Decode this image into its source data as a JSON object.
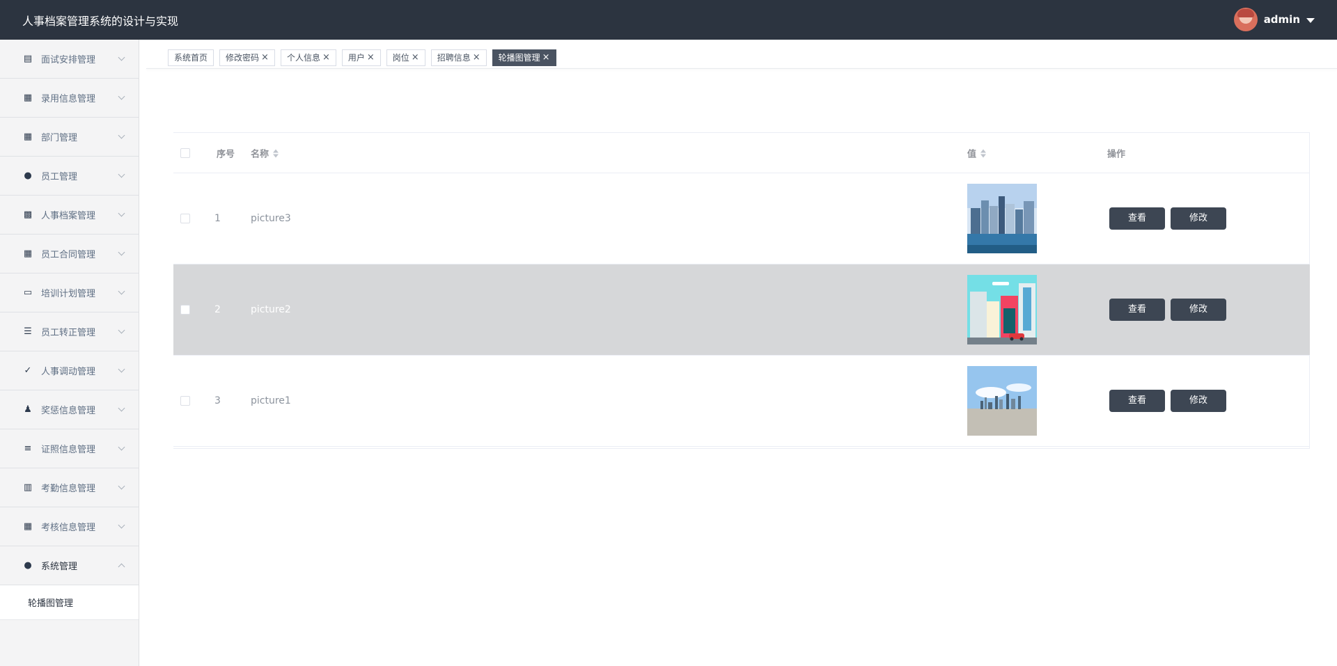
{
  "app": {
    "title": "人事档案管理系统的设计与实现"
  },
  "user": {
    "name": "admin"
  },
  "sidebar": {
    "items": [
      {
        "label": "面试安排管理",
        "icon": "clipboard-icon"
      },
      {
        "label": "录用信息管理",
        "icon": "grid-icon"
      },
      {
        "label": "部门管理",
        "icon": "grid-icon"
      },
      {
        "label": "员工管理",
        "icon": "balloon-icon"
      },
      {
        "label": "人事档案管理",
        "icon": "apps-icon"
      },
      {
        "label": "员工合同管理",
        "icon": "grid-icon"
      },
      {
        "label": "培训计划管理",
        "icon": "monitor-icon"
      },
      {
        "label": "员工转正管理",
        "icon": "list-icon"
      },
      {
        "label": "人事调动管理",
        "icon": "checklist-icon"
      },
      {
        "label": "奖惩信息管理",
        "icon": "user-icon"
      },
      {
        "label": "证照信息管理",
        "icon": "menu-icon"
      },
      {
        "label": "考勤信息管理",
        "icon": "bar-chart-icon"
      },
      {
        "label": "考核信息管理",
        "icon": "grid-icon"
      },
      {
        "label": "系统管理",
        "icon": "person-icon"
      }
    ],
    "submenu": {
      "label": "轮播图管理"
    }
  },
  "tabs": [
    {
      "label": "系统首页",
      "closable": false
    },
    {
      "label": "修改密码",
      "closable": true
    },
    {
      "label": "个人信息",
      "closable": true
    },
    {
      "label": "用户",
      "closable": true
    },
    {
      "label": "岗位",
      "closable": true
    },
    {
      "label": "招聘信息",
      "closable": true
    },
    {
      "label": "轮播图管理",
      "closable": true,
      "active": true
    }
  ],
  "table": {
    "headers": {
      "index": "序号",
      "name": "名称",
      "value": "值",
      "actions": "操作"
    },
    "rows": [
      {
        "index": "1",
        "name": "picture3",
        "image": "city-skyline-photo"
      },
      {
        "index": "2",
        "name": "picture2",
        "image": "cartoon-city-illustration"
      },
      {
        "index": "3",
        "name": "picture1",
        "image": "city-horizon-photo"
      }
    ],
    "buttons": {
      "view": "查看",
      "edit": "修改"
    }
  },
  "colors": {
    "topbar": "#2c3440",
    "button": "#3d4653",
    "active_tab": "#4a5361",
    "selected_row": "#d6d7d9"
  }
}
